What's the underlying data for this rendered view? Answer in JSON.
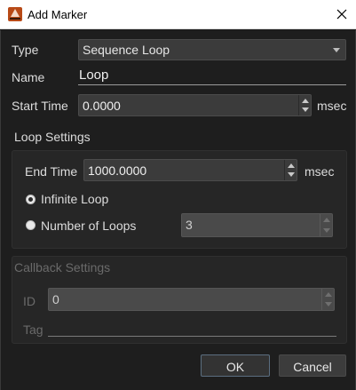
{
  "window": {
    "title": "Add Marker"
  },
  "form": {
    "type_label": "Type",
    "type_value": "Sequence Loop",
    "name_label": "Name",
    "name_value": "Loop",
    "start_time_label": "Start Time",
    "start_time_value": "0.0000",
    "start_time_unit": "msec"
  },
  "loop_settings": {
    "title": "Loop Settings",
    "end_time_label": "End Time",
    "end_time_value": "1000.0000",
    "end_time_unit": "msec",
    "infinite_loop_label": "Infinite Loop",
    "infinite_loop_selected": true,
    "number_of_loops_label": "Number of Loops",
    "number_of_loops_value": "3"
  },
  "callback_settings": {
    "title": "Callback Settings",
    "id_label": "ID",
    "id_value": "0",
    "tag_label": "Tag",
    "tag_value": ""
  },
  "buttons": {
    "ok_label": "OK",
    "cancel_label": "Cancel"
  },
  "icons": {
    "app": "app-logo-icon",
    "close": "close-icon",
    "dropdown": "chevron-down-icon",
    "spin_up": "spin-up-icon",
    "spin_down": "spin-down-icon"
  },
  "colors": {
    "background": "#1e1e1e",
    "group_background": "#262626",
    "field_background": "#3b3b3b",
    "accent_border": "#5b6e80",
    "app_icon": "#b84a17"
  }
}
